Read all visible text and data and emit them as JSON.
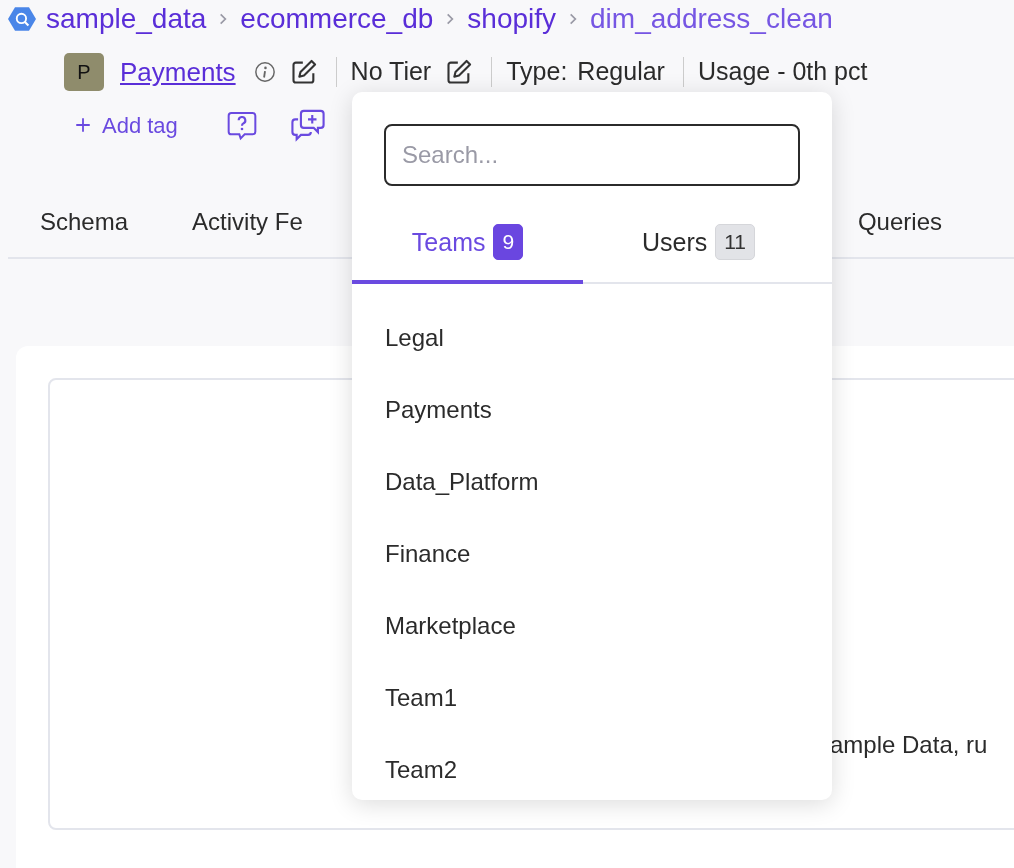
{
  "breadcrumb": [
    {
      "label": "sample_data",
      "current": false
    },
    {
      "label": "ecommerce_db",
      "current": false
    },
    {
      "label": "shopify",
      "current": false
    },
    {
      "label": "dim_address_clean",
      "current": true
    }
  ],
  "owner": {
    "initial": "P",
    "name": "Payments"
  },
  "tier": "No Tier",
  "type": {
    "label": "Type:",
    "value": "Regular"
  },
  "usage": "Usage - 0th pct",
  "add_tag": "Add tag",
  "tabs": [
    {
      "label": "Schema"
    },
    {
      "label": "Activity Fe"
    },
    {
      "label": "Queries"
    }
  ],
  "content": {
    "text": "ample Data, ru"
  },
  "owner_dropdown": {
    "search": {
      "placeholder": "Search..."
    },
    "tabs": [
      {
        "label": "Teams",
        "count": "9",
        "selected": true
      },
      {
        "label": "Users",
        "count": "11",
        "selected": false
      }
    ],
    "items": [
      "Legal",
      "Payments",
      "Data_Platform",
      "Finance",
      "Marketplace",
      "Team1",
      "Team2"
    ]
  }
}
